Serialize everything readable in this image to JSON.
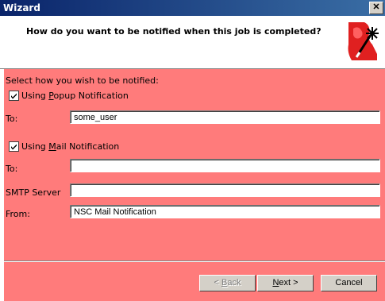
{
  "window": {
    "title": "Wizard",
    "close_glyph": "✕"
  },
  "header": {
    "question": "How do you want to be notified when this job is completed?",
    "icon": "wizard-wand-icon"
  },
  "form": {
    "intro": "Select how you wish to be notified:",
    "popup": {
      "checked": true,
      "label_pre": "Using ",
      "label_hot": "P",
      "label_post": "opup Notification",
      "to_label": "To:",
      "to_value": "some_user"
    },
    "mail": {
      "checked": true,
      "label_pre": "Using ",
      "label_hot": "M",
      "label_post": "ail Notification",
      "to_label": "To:",
      "to_value": "",
      "smtp_label": "SMTP Server",
      "smtp_value": "",
      "from_label": "From:",
      "from_value": "NSC Mail Notification"
    }
  },
  "buttons": {
    "back": {
      "pre": "< ",
      "hot": "B",
      "post": "ack"
    },
    "next": {
      "hot": "N",
      "post": "ext >"
    },
    "cancel": "Cancel"
  },
  "colors": {
    "panel": "#ff7b7b",
    "titlebar": "#0a246a"
  }
}
